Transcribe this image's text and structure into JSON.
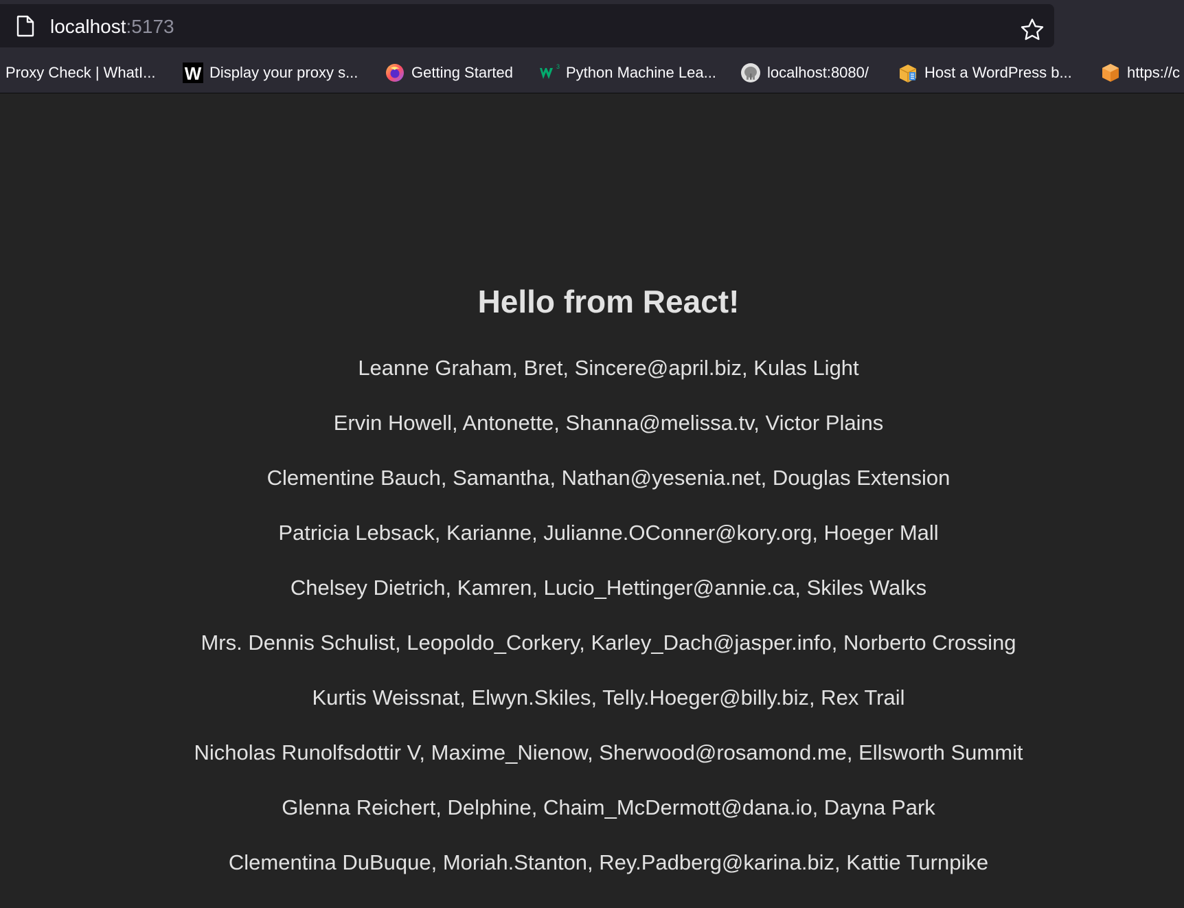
{
  "browser": {
    "url_host": "localhost",
    "url_port": ":5173",
    "bookmarks": [
      {
        "label": "Proxy Check | WhatI...",
        "icon": "globe-icon"
      },
      {
        "label": "Display your proxy s...",
        "icon": "w-logo-icon"
      },
      {
        "label": "Getting Started",
        "icon": "firefox-icon"
      },
      {
        "label": "Python Machine Lea...",
        "icon": "w3schools-icon"
      },
      {
        "label": "localhost:8080/",
        "icon": "elephant-icon"
      },
      {
        "label": "Host a WordPress b...",
        "icon": "box-icon"
      },
      {
        "label": "https://c",
        "icon": "cube-icon"
      }
    ]
  },
  "page": {
    "heading": "Hello from React!",
    "users": [
      "Leanne Graham, Bret, Sincere@april.biz, Kulas Light",
      "Ervin Howell, Antonette, Shanna@melissa.tv, Victor Plains",
      "Clementine Bauch, Samantha, Nathan@yesenia.net, Douglas Extension",
      "Patricia Lebsack, Karianne, Julianne.OConner@kory.org, Hoeger Mall",
      "Chelsey Dietrich, Kamren, Lucio_Hettinger@annie.ca, Skiles Walks",
      "Mrs. Dennis Schulist, Leopoldo_Corkery, Karley_Dach@jasper.info, Norberto Crossing",
      "Kurtis Weissnat, Elwyn.Skiles, Telly.Hoeger@billy.biz, Rex Trail",
      "Nicholas Runolfsdottir V, Maxime_Nienow, Sherwood@rosamond.me, Ellsworth Summit",
      "Glenna Reichert, Delphine, Chaim_McDermott@dana.io, Dayna Park",
      "Clementina DuBuque, Moriah.Stanton, Rey.Padberg@karina.biz, Kattie Turnpike"
    ]
  },
  "colors": {
    "page_background": "#242424",
    "text": "#dedede",
    "toolbar": "#2b2a33",
    "urlbar": "#1c1b22"
  }
}
